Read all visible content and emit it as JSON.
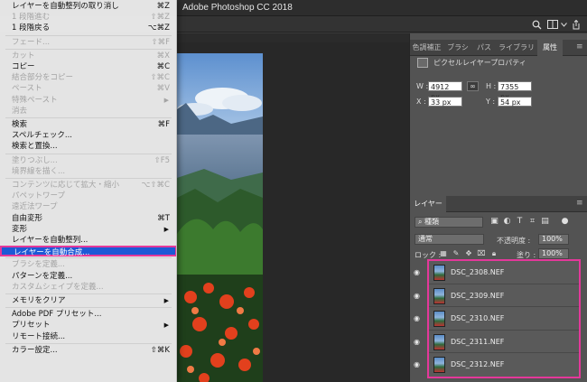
{
  "window": {
    "title": "Adobe Photoshop CC 2018"
  },
  "options_icons": [
    "search-icon",
    "window-layout-icon",
    "share-icon"
  ],
  "edit_menu": {
    "items": [
      {
        "label": "レイヤーを自動整列の取り消し",
        "shortcut": "⌘Z",
        "enabled": true
      },
      {
        "label": "1 段階進む",
        "shortcut": "⇧⌘Z",
        "enabled": false
      },
      {
        "label": "1 段階戻る",
        "shortcut": "⌥⌘Z",
        "enabled": true
      },
      {
        "separator": true
      },
      {
        "label": "フェード...",
        "shortcut": "⇧⌘F",
        "enabled": false
      },
      {
        "separator": true
      },
      {
        "label": "カット",
        "shortcut": "⌘X",
        "enabled": false
      },
      {
        "label": "コピー",
        "shortcut": "⌘C",
        "enabled": true
      },
      {
        "label": "結合部分をコピー",
        "shortcut": "⇧⌘C",
        "enabled": false
      },
      {
        "label": "ペースト",
        "shortcut": "⌘V",
        "enabled": false
      },
      {
        "label": "特殊ペースト",
        "submenu": true,
        "enabled": false
      },
      {
        "label": "消去",
        "enabled": false
      },
      {
        "separator": true
      },
      {
        "label": "検索",
        "shortcut": "⌘F",
        "enabled": true
      },
      {
        "label": "スペルチェック...",
        "enabled": true
      },
      {
        "label": "検索と置換...",
        "enabled": true
      },
      {
        "separator": true
      },
      {
        "label": "塗りつぶし...",
        "shortcut": "⇧F5",
        "enabled": false
      },
      {
        "label": "境界線を描く...",
        "enabled": false
      },
      {
        "separator": true
      },
      {
        "label": "コンテンツに応じて拡大・縮小",
        "shortcut": "⌥⇧⌘C",
        "enabled": false
      },
      {
        "label": "パペットワープ",
        "enabled": false
      },
      {
        "label": "遠近法ワープ",
        "enabled": false
      },
      {
        "label": "自由変形",
        "shortcut": "⌘T",
        "enabled": true
      },
      {
        "label": "変形",
        "submenu": true,
        "enabled": true
      },
      {
        "label": "レイヤーを自動整列...",
        "enabled": true
      },
      {
        "label": "レイヤーを自動合成...",
        "enabled": true,
        "highlighted": true
      },
      {
        "separator": true
      },
      {
        "label": "ブラシを定義...",
        "enabled": false
      },
      {
        "label": "パターンを定義...",
        "enabled": true
      },
      {
        "label": "カスタムシェイプを定義...",
        "enabled": false
      },
      {
        "separator": true
      },
      {
        "label": "メモリをクリア",
        "submenu": true,
        "enabled": true
      },
      {
        "separator": true
      },
      {
        "label": "Adobe PDF プリセット...",
        "enabled": true
      },
      {
        "label": "プリセット",
        "submenu": true,
        "enabled": true
      },
      {
        "label": "リモート接続...",
        "enabled": true
      },
      {
        "separator": true
      },
      {
        "label": "カラー設定...",
        "shortcut": "⇧⌘K",
        "enabled": true
      }
    ]
  },
  "properties_panel": {
    "tabs": [
      "色調補正",
      "ブラシ",
      "パス",
      "ライブラリ",
      "属性"
    ],
    "active_tab": "属性",
    "title": "ピクセルレイヤープロパティ",
    "w_label": "W :",
    "w_value": "4912 px",
    "h_label": "H :",
    "h_value": "7355 px",
    "x_label": "X :",
    "x_value": "33 px",
    "y_label": "Y :",
    "y_value": "54 px"
  },
  "layers_panel": {
    "tab": "レイヤー",
    "filter_label": "種類",
    "blend_mode": "通常",
    "opacity_label": "不透明度 :",
    "opacity_value": "100%",
    "lock_label": "ロック :",
    "fill_label": "塗り :",
    "fill_value": "100%",
    "layers": [
      {
        "name": "DSC_2308.NEF"
      },
      {
        "name": "DSC_2309.NEF"
      },
      {
        "name": "DSC_2310.NEF"
      },
      {
        "name": "DSC_2311.NEF"
      },
      {
        "name": "DSC_2312.NEF"
      }
    ],
    "highlight_color": "#e4389a"
  },
  "colors": {
    "menu_highlight": "#1d59d6",
    "annotation": "#e4389a"
  }
}
